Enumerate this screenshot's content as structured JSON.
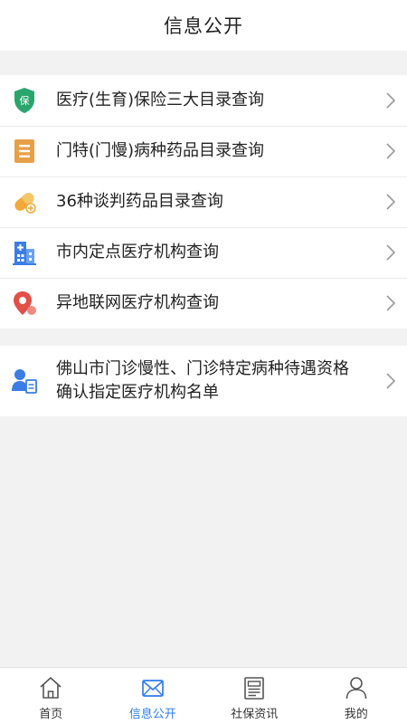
{
  "header": {
    "title": "信息公开"
  },
  "colors": {
    "accent": "#2f7cf0",
    "green": "#2aa56d",
    "orange": "#e8a048",
    "red": "#e24f46",
    "blue": "#3b7ce6"
  },
  "menu_group1": [
    {
      "label": "医疗(生育)保险三大目录查询",
      "icon": "insurance-shield-icon",
      "icon_text": "保"
    },
    {
      "label": "门特(门慢)病种药品目录查询",
      "icon": "list-document-icon"
    },
    {
      "label": "36种谈判药品目录查询",
      "icon": "pill-capsule-icon"
    },
    {
      "label": "市内定点医疗机构查询",
      "icon": "hospital-building-icon"
    },
    {
      "label": "异地联网医疗机构查询",
      "icon": "location-pin-icon"
    }
  ],
  "menu_group2": [
    {
      "label": "佛山市门诊慢性、门诊特定病种待遇资格确认指定医疗机构名单",
      "icon": "person-document-icon"
    }
  ],
  "tabbar": {
    "items": [
      {
        "label": "首页",
        "icon": "home-icon",
        "active": false
      },
      {
        "label": "信息公开",
        "icon": "mail-envelope-icon",
        "active": true
      },
      {
        "label": "社保资讯",
        "icon": "newspaper-icon",
        "active": false
      },
      {
        "label": "我的",
        "icon": "person-icon",
        "active": false
      }
    ]
  }
}
